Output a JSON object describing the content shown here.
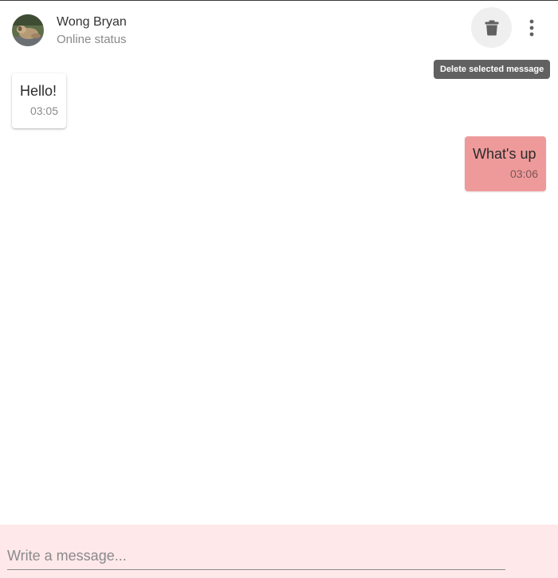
{
  "header": {
    "contact_name": "Wong Bryan",
    "contact_status": "Online status",
    "avatar_icon": "user-avatar-photo",
    "delete_icon": "trash-icon",
    "more_icon": "more-vert-icon"
  },
  "tooltip": {
    "text": "Delete selected message"
  },
  "messages": [
    {
      "direction": "incoming",
      "text": "Hello!",
      "time": "03:05"
    },
    {
      "direction": "outgoing",
      "text": "What's up",
      "time": "03:06"
    }
  ],
  "composer": {
    "placeholder": "Write a message..."
  },
  "colors": {
    "outgoing_bubble": "#ef9a9a",
    "composer_background": "#ffe8ea",
    "tooltip_background": "#616161"
  }
}
